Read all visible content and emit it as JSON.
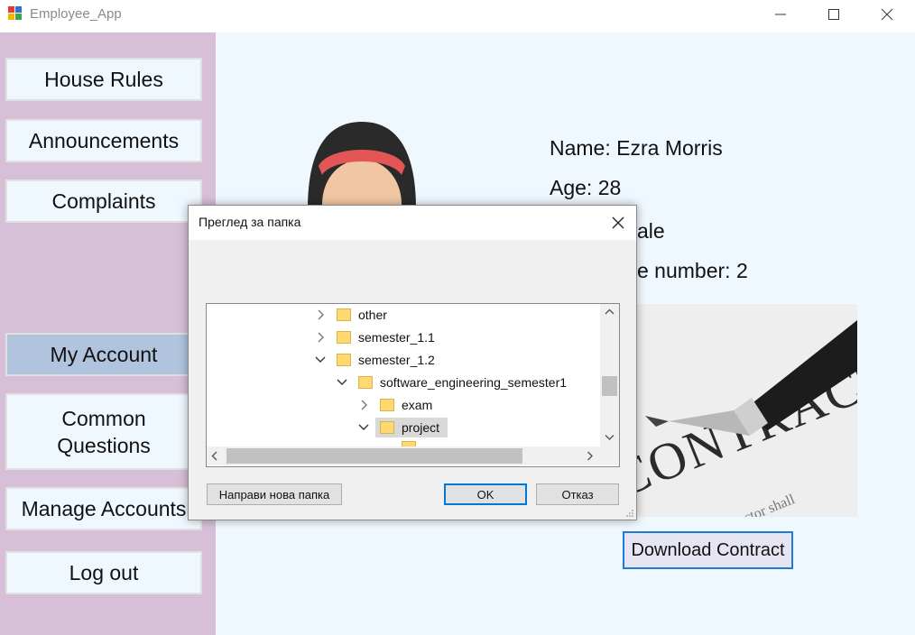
{
  "window": {
    "title": "Employee_App"
  },
  "sidebar": {
    "items": [
      {
        "label": "House Rules"
      },
      {
        "label": "Announcements"
      },
      {
        "label": "Complaints"
      },
      {
        "label": "My Account",
        "active": true
      },
      {
        "label_line1": "Common",
        "label_line2": "Questions"
      },
      {
        "label": "Manage Accounts"
      },
      {
        "label": "Log out"
      }
    ]
  },
  "profile": {
    "name": "Name: Ezra Morris",
    "age": "Age: 28",
    "gender_partial": "ale",
    "phone_partial": "e number: 2"
  },
  "contract": {
    "image_text": "CONTRACT",
    "download_label": "Download Contract"
  },
  "dialog": {
    "title": "Преглед за папка",
    "tree": [
      {
        "label": "other",
        "expanded": false
      },
      {
        "label": "semester_1.1",
        "expanded": false
      },
      {
        "label": "semester_1.2",
        "expanded": true
      },
      {
        "label": "software_engineering_semester1",
        "expanded": true
      },
      {
        "label": "exam",
        "expanded": false
      },
      {
        "label": "project",
        "expanded": true,
        "selected": true
      }
    ],
    "new_folder_label": "Направи нова папка",
    "ok_label": "OK",
    "cancel_label": "Отказ"
  },
  "colors": {
    "sidebar_bg": "#d8bfd8",
    "main_bg": "#f0f8ff",
    "active_button": "#b0c4de",
    "accent": "#0078d7",
    "folder": "#ffd870"
  }
}
